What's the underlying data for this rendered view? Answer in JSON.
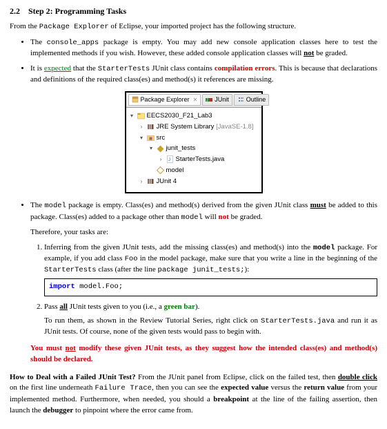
{
  "heading": {
    "number": "2.2",
    "title": "Step 2: Programming Tasks"
  },
  "intro_a": "From the ",
  "intro_pkg": "Package Explorer",
  "intro_b": " of Eclipse, your imported project has the following structure.",
  "b1_a": "The ",
  "b1_console": "console_apps",
  "b1_b": " package is empty. You may add new console application classes here to test the implemented methods if you wish. However, these added console application classes will ",
  "b1_not": "not",
  "b1_c": " be graded.",
  "b2_a": "It is ",
  "b2_expected": "expected",
  "b2_b": " that the ",
  "b2_starter": "StarterTests",
  "b2_c": " JUnit class contains ",
  "b2_comp": "compilation errors",
  "b2_d": ". This is because that declarations and definitions of the required class(es) and method(s) it references are missing.",
  "explorer": {
    "tab1": "Package Explorer",
    "tab1_x": "✕",
    "tab2": "JUnit",
    "tab3": "Outline",
    "project": "EECS2030_F21_Lab3",
    "jre_a": "JRE System Library",
    "jre_b": " [JavaSE-1.8]",
    "src": "src",
    "pkg_junit": "junit_tests",
    "file_starter": "StarterTests.java",
    "pkg_model": "model",
    "junit4": "JUnit 4"
  },
  "b3_a": "The ",
  "b3_model": "model",
  "b3_b": " package is empty. Class(es) and method(s) derived from the given JUnit class ",
  "b3_must": "must",
  "b3_c": " be added to this package. Class(es) added to a package other than ",
  "b3_model2": "model",
  "b3_d": " will ",
  "b3_not": "not",
  "b3_e": " be graded.",
  "therefore": "Therefore, your tasks are:",
  "n1_a": "Inferring from the given JUnit tests, add the missing class(es) and method(s) into the ",
  "n1_model": "model",
  "n1_b": " package. For example, if you add class ",
  "n1_foo": "Foo",
  "n1_c": " in the model package, make sure that you write a line in the beginning of the ",
  "n1_starter": "StarterTests",
  "n1_d": " class (after the line ",
  "n1_pkgline": "package junit_tests;",
  "n1_e": "):",
  "code_import": "import",
  "code_rest": " model.Foo;",
  "n2_a": "Pass ",
  "n2_all": "all",
  "n2_b": " JUnit tests given to you (i.e., a ",
  "n2_green": "green bar",
  "n2_c": ").",
  "n2_run_a": "To run them, as shown in the Review Tutorial Series, right click on ",
  "n2_run_st": "StarterTests.java",
  "n2_run_b": " and run it as JUnit tests. Of course, none of the given tests would pass to begin with.",
  "warn_a": "You must ",
  "warn_not": "not",
  "warn_b": " modify these given JUnit tests, as they suggest how the intended class(es) and method(s) should be declared.",
  "fail_heading": "How to Deal with a Failed JUnit Test?",
  "fail_a": " From the JUnit panel from Eclipse, click on the failed test, then ",
  "fail_dbl": "double click",
  "fail_b": " on the first line underneath ",
  "fail_trace": "Failure Trace",
  "fail_c": ", then you can see the ",
  "fail_exp": "expected value",
  "fail_d": " versus the ",
  "fail_ret": "return value",
  "fail_e": " from your implemented method. Furthermore, when needed, you should a ",
  "fail_bp": "breakpoint",
  "fail_f": " at the line of the failing assertion, then launch the ",
  "fail_dbg": "debugger",
  "fail_g": " to pinpoint where the error came from."
}
